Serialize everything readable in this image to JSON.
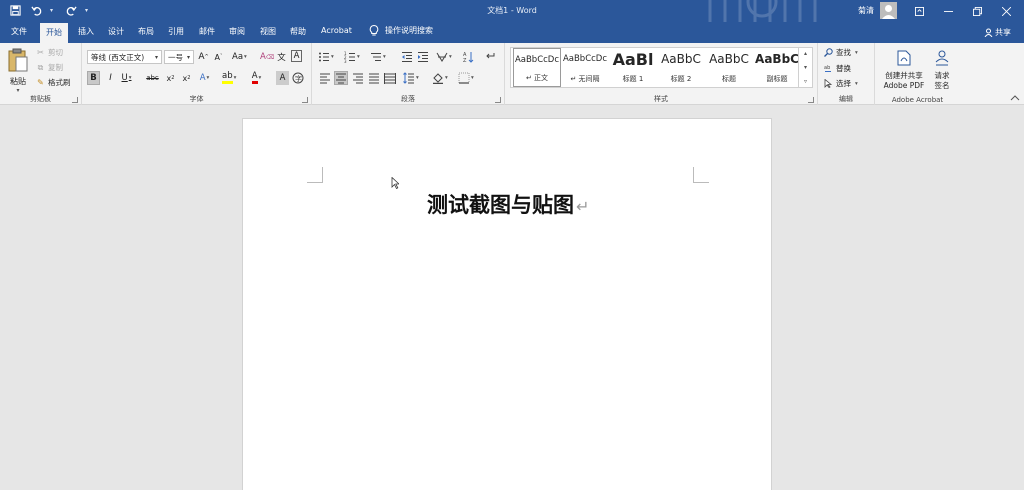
{
  "titlebar": {
    "title": "文档1 - Word",
    "user_name": "菊清",
    "bg_color": "#2b579a"
  },
  "qat": {
    "icons": [
      "save-icon",
      "undo-icon",
      "redo-icon",
      "customize-icon"
    ]
  },
  "tabs": [
    {
      "label": "文件"
    },
    {
      "label": "开始",
      "active": true
    },
    {
      "label": "插入"
    },
    {
      "label": "设计"
    },
    {
      "label": "布局"
    },
    {
      "label": "引用"
    },
    {
      "label": "邮件"
    },
    {
      "label": "审阅"
    },
    {
      "label": "视图"
    },
    {
      "label": "帮助"
    },
    {
      "label": "Acrobat"
    }
  ],
  "tell_me": "操作说明搜索",
  "share_label": "共享",
  "clipboard": {
    "paste": "粘贴",
    "cut": "剪切",
    "copy": "复制",
    "format_painter": "格式刷",
    "group_label": "剪贴板"
  },
  "font": {
    "font_name": "等线 (西文正文)",
    "font_size": "一号",
    "group_label": "字体",
    "aa_label": "Aa",
    "wen_label": "文",
    "a_label": "A"
  },
  "paragraph": {
    "group_label": "段落"
  },
  "styles": {
    "group_label": "样式",
    "items": [
      {
        "sample": "AaBbCcDc",
        "name": "↵ 正文"
      },
      {
        "sample": "AaBbCcDc",
        "name": "↵ 无间隔"
      },
      {
        "sample": "AaBl",
        "name": "标题 1"
      },
      {
        "sample": "AaBbC",
        "name": "标题 2"
      },
      {
        "sample": "AaBbC",
        "name": "标题"
      },
      {
        "sample": "AaBbC",
        "name": "副标题"
      }
    ]
  },
  "editing": {
    "find": "查找",
    "replace": "替换",
    "select": "选择",
    "group_label": "编辑"
  },
  "acrobat": {
    "create_line1": "创建并共享",
    "create_line2": "Adobe PDF",
    "sign_line1": "请求",
    "sign_line2": "签名",
    "group_label": "Adobe Acrobat"
  },
  "document": {
    "heading": "测试截图与贴图",
    "paragraph_mark": "↵"
  }
}
